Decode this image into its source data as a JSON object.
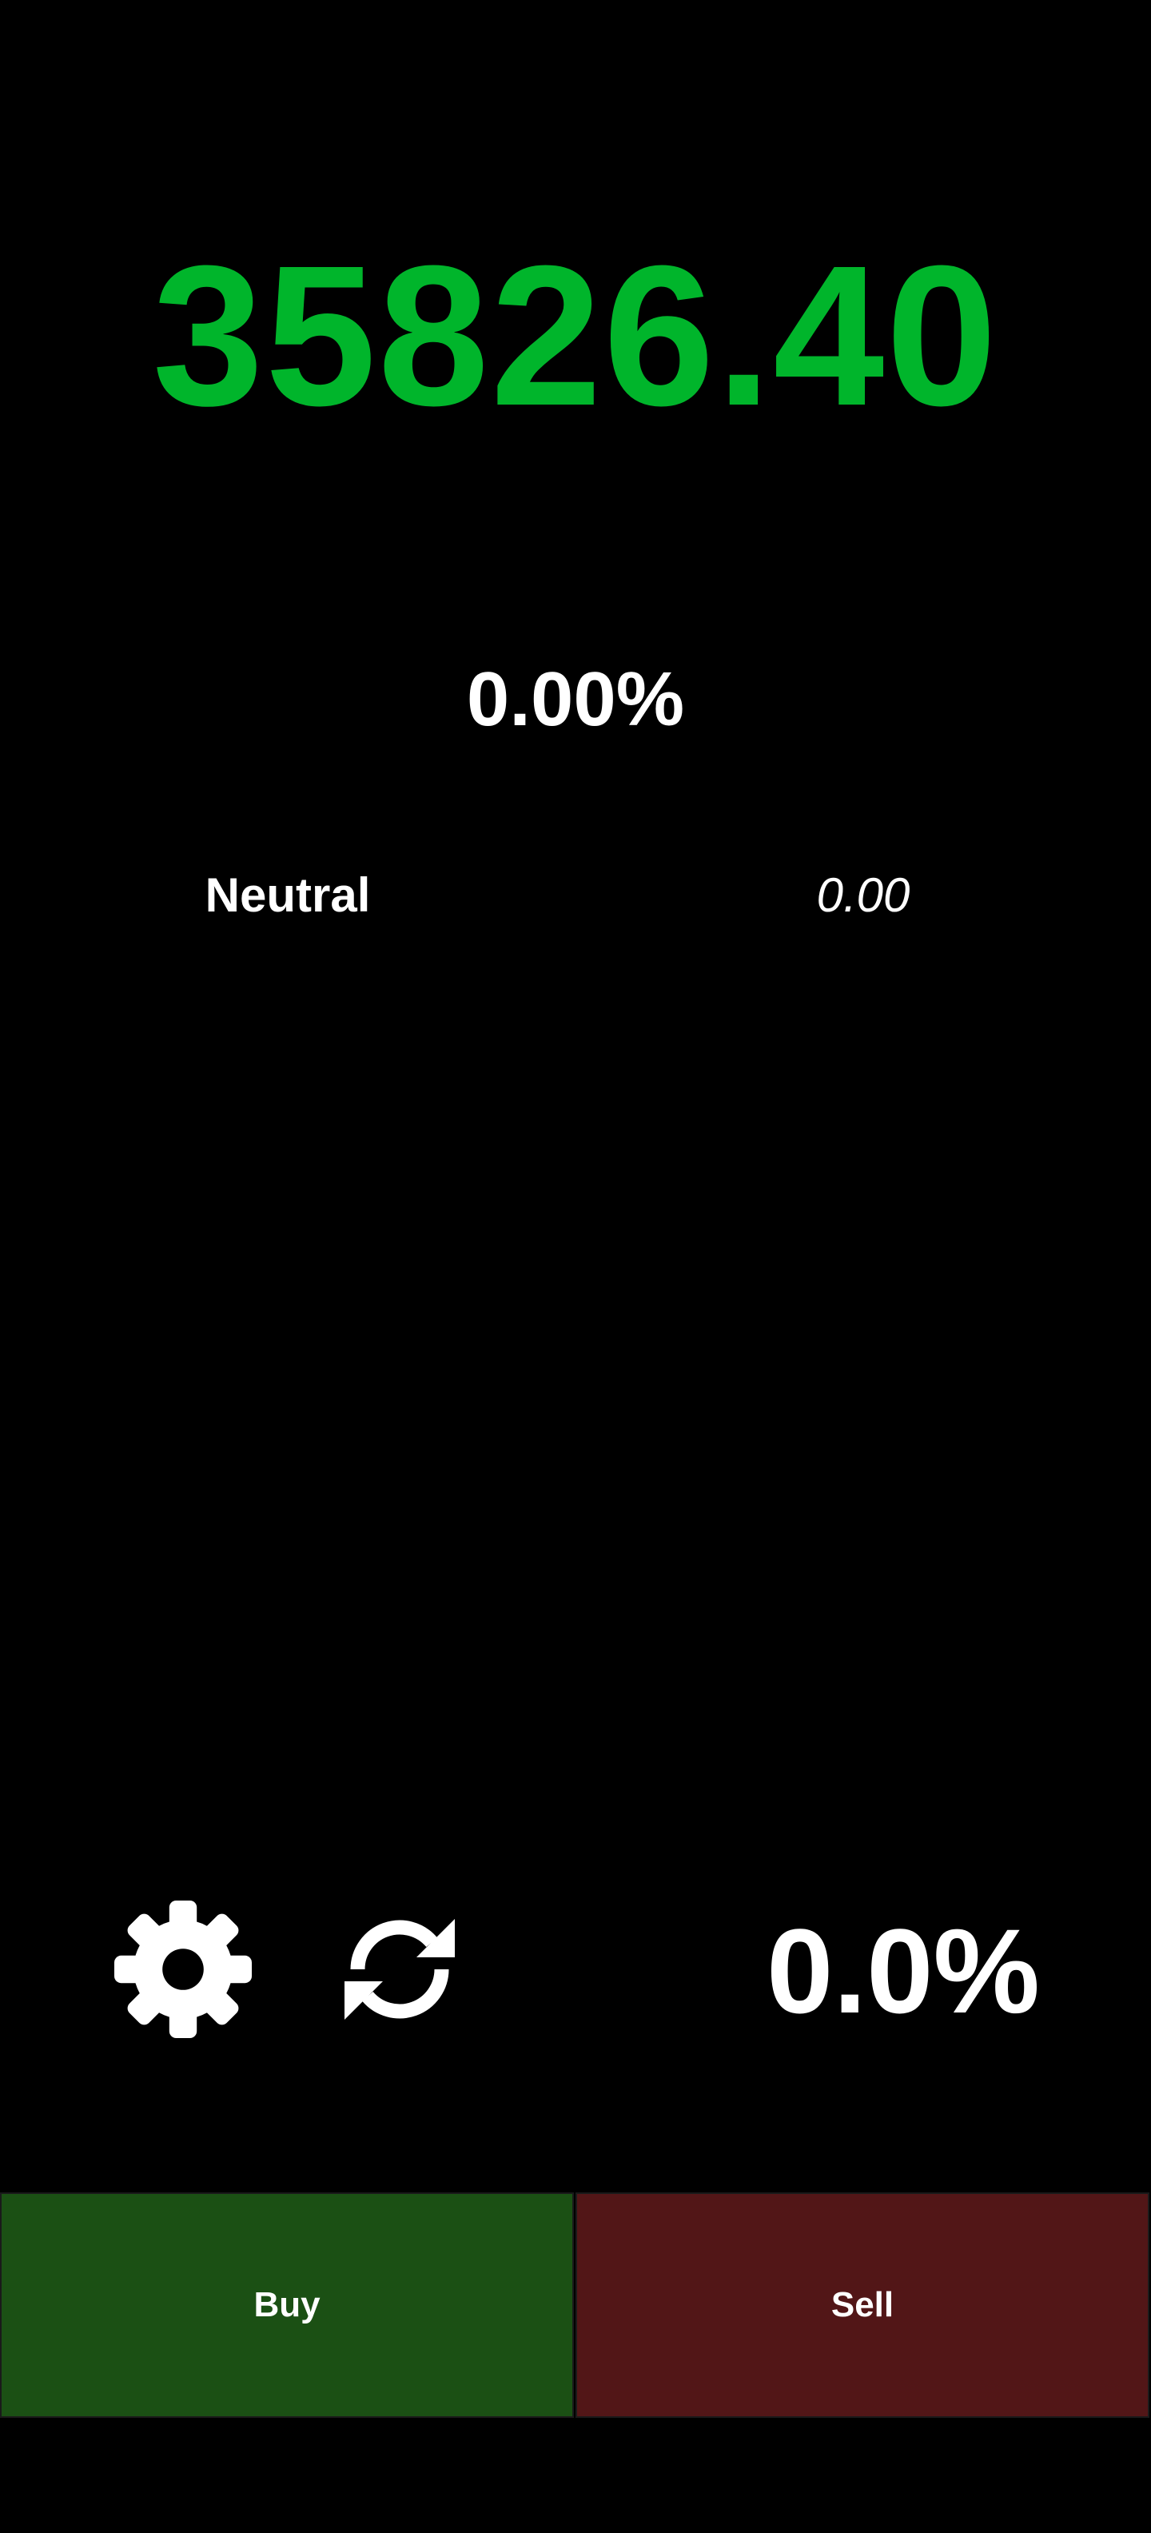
{
  "price": {
    "value": "35826.40",
    "color": "#00b52b"
  },
  "change": {
    "percent": "0.00%"
  },
  "sentiment": {
    "label": "Neutral",
    "value": "0.00"
  },
  "toolbar": {
    "settings_icon": "gear-icon",
    "refresh_icon": "refresh-icon",
    "percent": "0.0%"
  },
  "actions": {
    "buy_label": "Buy",
    "buy_color": "#1b5014",
    "sell_label": "Sell",
    "sell_color": "#521617"
  }
}
